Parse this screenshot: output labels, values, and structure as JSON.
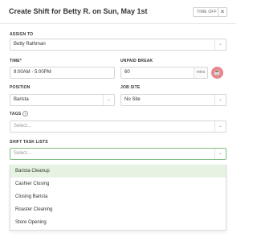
{
  "header": {
    "title": "Create Shift for Betty R. on Sun, May 1st",
    "time_off_label": "TIME OFF",
    "close_label": "×"
  },
  "assign_to": {
    "label": "ASSIGN TO",
    "value": "Betty Rathman"
  },
  "time": {
    "label": "TIME*",
    "value": "9:00AM - 5:00PM"
  },
  "unpaid_break": {
    "label": "UNPAID BREAK",
    "value": "60",
    "unit": "mins"
  },
  "position": {
    "label": "POSITION",
    "value": "Barista"
  },
  "job_site": {
    "label": "JOB SITE",
    "value": "No Site"
  },
  "tags": {
    "label": "TAGS",
    "placeholder": "Select..."
  },
  "shift_task_lists": {
    "label": "SHIFT TASK LISTS",
    "placeholder": "Select...",
    "options": [
      "Barista Cleanup",
      "Cashier Closing",
      "Closing Barista",
      "Roaster Cleaning",
      "Store Opening"
    ],
    "highlighted_option": "Barista Cleanup"
  },
  "colors": {
    "accent_green": "#7bbf7b",
    "highlight_bg": "#e6f3e2",
    "break_button": "#e8888b"
  },
  "icons": {
    "chevron": "chevron-down-icon",
    "help": "help-icon",
    "break": "coffee-icon",
    "close": "close-icon"
  }
}
